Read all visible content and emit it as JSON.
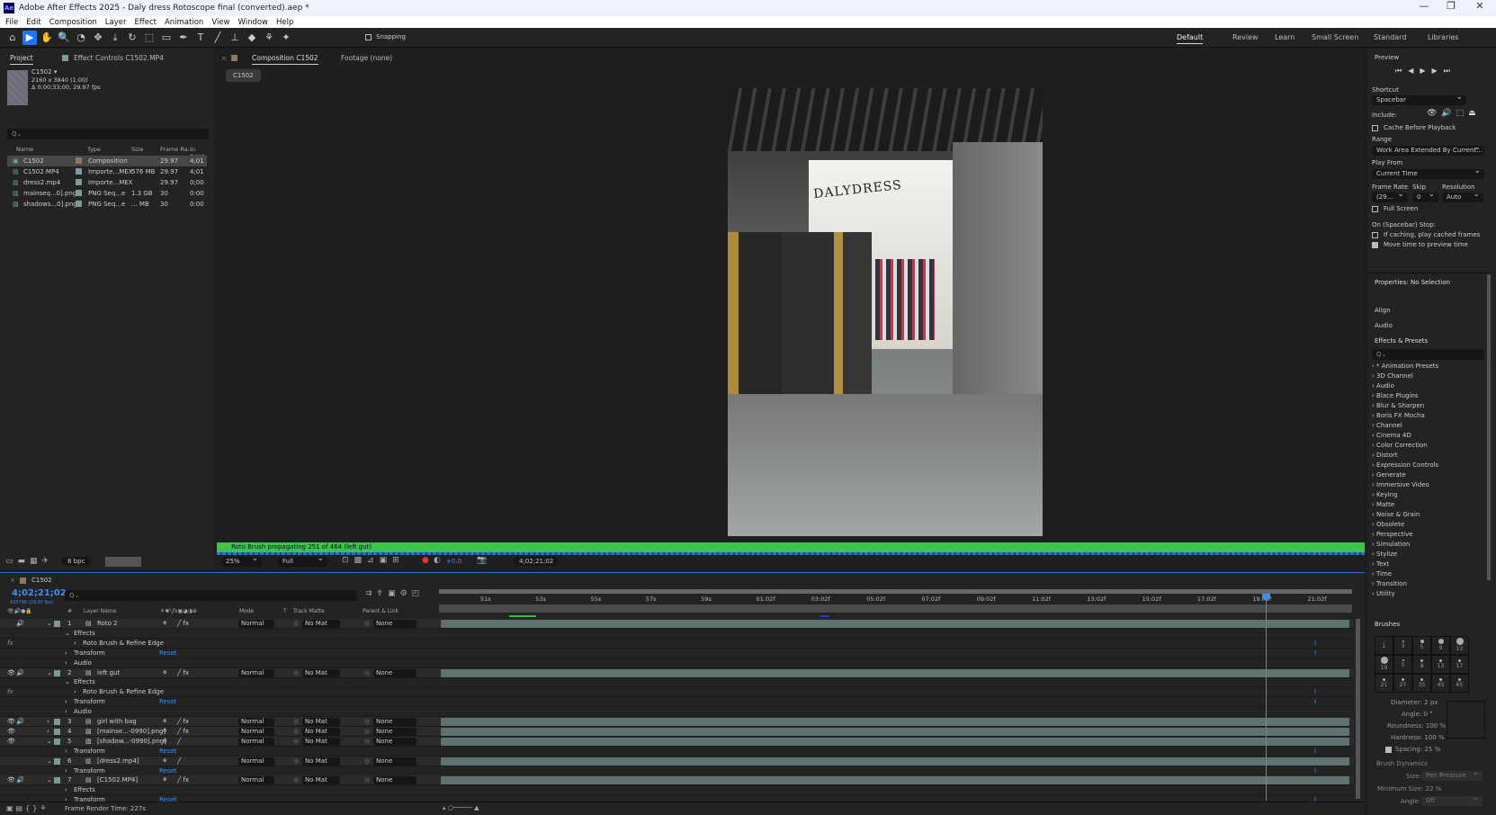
{
  "window": {
    "title": "Adobe After Effects 2025 - Daly dress Rotoscope final (converted).aep *",
    "logo": "Ae",
    "controls": [
      "—",
      "❐",
      "✕"
    ]
  },
  "menu": [
    "File",
    "Edit",
    "Composition",
    "Layer",
    "Effect",
    "Animation",
    "View",
    "Window",
    "Help"
  ],
  "toolbar": {
    "tools": [
      "home-icon",
      "selection-icon",
      "hand-icon",
      "zoom-icon",
      "orbit-icon",
      "pan-icon",
      "dolly-icon",
      "rotate-icon",
      "anchor-icon",
      "rectangle-icon",
      "pen-icon",
      "type-icon",
      "brush-icon",
      "clone-stamp-icon",
      "eraser-icon",
      "roto-brush-icon",
      "puppet-icon"
    ],
    "glyphs": [
      "⌂",
      "▶",
      "✋",
      "🔍",
      "◔",
      "✥",
      "⤓",
      "↻",
      "⬚",
      "▭",
      "✒",
      "T",
      "╱",
      "⊥",
      "◆",
      "⚘",
      "✦"
    ],
    "snapping_label": "Snapping",
    "workspaces": [
      "Default",
      "Review",
      "Learn",
      "Small Screen",
      "Standard",
      "Libraries"
    ],
    "active_workspace": "Default"
  },
  "project": {
    "tab_project": "Project",
    "tab_effect_controls": "Effect Controls C1502.MP4",
    "comp_name": "C1502 ▾",
    "comp_size": "2160 x 3840 (1.00)",
    "comp_duration": "Δ 0;00;33;00, 29.97 fps",
    "search_placeholder": "Q⌄",
    "columns": [
      "Name",
      "Type",
      "Size",
      "Frame Ra...",
      "In Point"
    ],
    "items": [
      {
        "name": "C1502",
        "type": "Composition",
        "size": "",
        "fps": "29.97",
        "in": "4;01",
        "color": "#8a7a63",
        "icon": "▣"
      },
      {
        "name": "C1502.MP4",
        "type": "Importe...MEX",
        "size": "576 MB",
        "fps": "29.97",
        "in": "4;01",
        "color": "#7f9998",
        "icon": "▤"
      },
      {
        "name": "dress2.mp4",
        "type": "Importe...MEX",
        "size": "",
        "fps": "29.97",
        "in": "0;00",
        "color": "#7f9998",
        "icon": "▥"
      },
      {
        "name": "mainseq...0].png",
        "type": "PNG Seq...e",
        "size": "1.3 GB",
        "fps": "30",
        "in": "0:00",
        "color": "#7f9998",
        "icon": "▧"
      },
      {
        "name": "shadows...0].png",
        "type": "PNG Seq...e",
        "size": "... MB",
        "fps": "30",
        "in": "0:00",
        "color": "#7f9998",
        "icon": "▧"
      }
    ],
    "bpc": "8 bpc"
  },
  "viewer": {
    "tab_comp": "Composition C1502",
    "tab_footage": "Footage (none)",
    "comp_button": "C1502",
    "store_sign": "DALYDRESS",
    "status": "Roto Brush propagating 251 of 464 (left gut)",
    "status_color": "#3ec24a",
    "zoom": "25%",
    "resolution": "Full",
    "exposure": "+0.0",
    "timecode": "4;02;21;02"
  },
  "preview": {
    "title": "Preview",
    "shortcut_label": "Shortcut",
    "shortcut": "Spacebar",
    "include_label": "Include:",
    "cache_label": "Cache Before Playback",
    "cache": false,
    "range_label": "Range",
    "range": "Work Area Extended By Current...",
    "play_from_label": "Play From",
    "play_from": "Current Time",
    "frame_rate_label": "Frame Rate",
    "frame_rate": "(29...",
    "skip_label": "Skip",
    "skip": "0",
    "resolution_label": "Resolution",
    "resolution": "Auto",
    "full_screen_label": "Full Screen",
    "full_screen": false,
    "stop_label": "On (Spacebar) Stop:",
    "if_caching_label": "If caching, play cached frames",
    "if_caching": false,
    "move_time_label": "Move time to preview time",
    "move_time": true
  },
  "properties": {
    "title": "Properties: No Selection",
    "align": "Align",
    "audio": "Audio"
  },
  "effects": {
    "title": "Effects & Presets",
    "search_placeholder": "Q⌄",
    "items": [
      "* Animation Presets",
      "3D Channel",
      "Audio",
      "Blace Plugins",
      "Blur & Sharpen",
      "Boris FX Mocha",
      "Channel",
      "Cinema 4D",
      "Color Correction",
      "Distort",
      "Expression Controls",
      "Generate",
      "Immersive Video",
      "Keying",
      "Matte",
      "Noise & Grain",
      "Obsolete",
      "Perspective",
      "Simulation",
      "Stylize",
      "Text",
      "Time",
      "Transition",
      "Utility"
    ]
  },
  "brushes": {
    "title": "Brushes",
    "sizes": [
      "1",
      "3",
      "5",
      "9",
      "13",
      "19",
      "5",
      "9",
      "13",
      "17",
      "21",
      "27",
      "35",
      "45",
      "65"
    ],
    "diameter": "Diameter: 2 px",
    "angle": "Angle: 0 °",
    "roundness": "Roundness: 100 %",
    "hardness": "Hardness: 100 %",
    "spacing": "Spacing: 25 %",
    "dynamics": "Brush Dynamics",
    "size_label": "Size:",
    "size_value": "Pen Pressure",
    "min_size": "Minimum Size: 22 %",
    "angle_label": "Angle:",
    "angle_value": "Off"
  },
  "timeline": {
    "tab": "C1502",
    "timecode": "4;02;21;02",
    "frames": "435796 (29.97 fps)",
    "search_placeholder": "Q⌄",
    "columns": {
      "num": "#",
      "name": "Layer Name",
      "mode": "Mode",
      "t": "T",
      "matte": "Track Matte",
      "parent": "Parent & Link"
    },
    "ruler": [
      "51s",
      "53s",
      "55s",
      "57s",
      "59s",
      "01:02f",
      "03:02f",
      "05:02f",
      "07:02f",
      "09:02f",
      "11:02f",
      "13:02f",
      "15:02f",
      "17:02f",
      "19:02f",
      "21:02f"
    ],
    "rows": [
      {
        "kind": "layer",
        "num": "1",
        "name": "Roto 2",
        "icon": "▤",
        "eye": false,
        "audio": true,
        "open": true,
        "fx": true
      },
      {
        "kind": "group",
        "indent": 1,
        "label": "Effects",
        "open": true
      },
      {
        "kind": "prop",
        "indent": 2,
        "label": "Roto Brush & Refine Edge",
        "fxmark": true
      },
      {
        "kind": "prop",
        "indent": 1,
        "label": "Transform",
        "reset": "Reset"
      },
      {
        "kind": "prop",
        "indent": 1,
        "label": "Audio"
      },
      {
        "kind": "layer",
        "num": "2",
        "name": "left gut",
        "icon": "▤",
        "eye": true,
        "audio": true,
        "open": true,
        "fx": true
      },
      {
        "kind": "group",
        "indent": 1,
        "label": "Effects",
        "open": true
      },
      {
        "kind": "prop",
        "indent": 2,
        "label": "Roto Brush & Refine Edge",
        "fxmark": true
      },
      {
        "kind": "prop",
        "indent": 1,
        "label": "Transform",
        "reset": "Reset"
      },
      {
        "kind": "prop",
        "indent": 1,
        "label": "Audio"
      },
      {
        "kind": "layer",
        "num": "3",
        "name": "girl with bag",
        "icon": "▤",
        "eye": true,
        "audio": true,
        "open": false,
        "fx": true
      },
      {
        "kind": "layer",
        "num": "4",
        "name": "[mainse...-0990].png]",
        "icon": "▧",
        "eye": true,
        "audio": false,
        "open": false,
        "fx": true
      },
      {
        "kind": "layer",
        "num": "5",
        "name": "[shadow...-0990].png]",
        "icon": "▧",
        "eye": true,
        "audio": false,
        "open": true,
        "fx": false
      },
      {
        "kind": "prop",
        "indent": 1,
        "label": "Transform",
        "reset": "Reset"
      },
      {
        "kind": "layer",
        "num": "6",
        "name": "[dress2.mp4]",
        "icon": "▥",
        "eye": false,
        "audio": false,
        "open": true,
        "fx": false
      },
      {
        "kind": "prop",
        "indent": 1,
        "label": "Transform",
        "reset": "Reset"
      },
      {
        "kind": "layer",
        "num": "7",
        "name": "[C1502.MP4]",
        "icon": "▤",
        "eye": true,
        "audio": true,
        "open": true,
        "fx": true
      },
      {
        "kind": "prop",
        "indent": 1,
        "label": "Effects"
      },
      {
        "kind": "prop",
        "indent": 1,
        "label": "Transform",
        "reset": "Reset"
      }
    ],
    "mode": "Normal",
    "matte": "No Mat",
    "parent": "None",
    "render_time": "Frame Render Time: 227s",
    "playhead_fraction": 0.905
  }
}
